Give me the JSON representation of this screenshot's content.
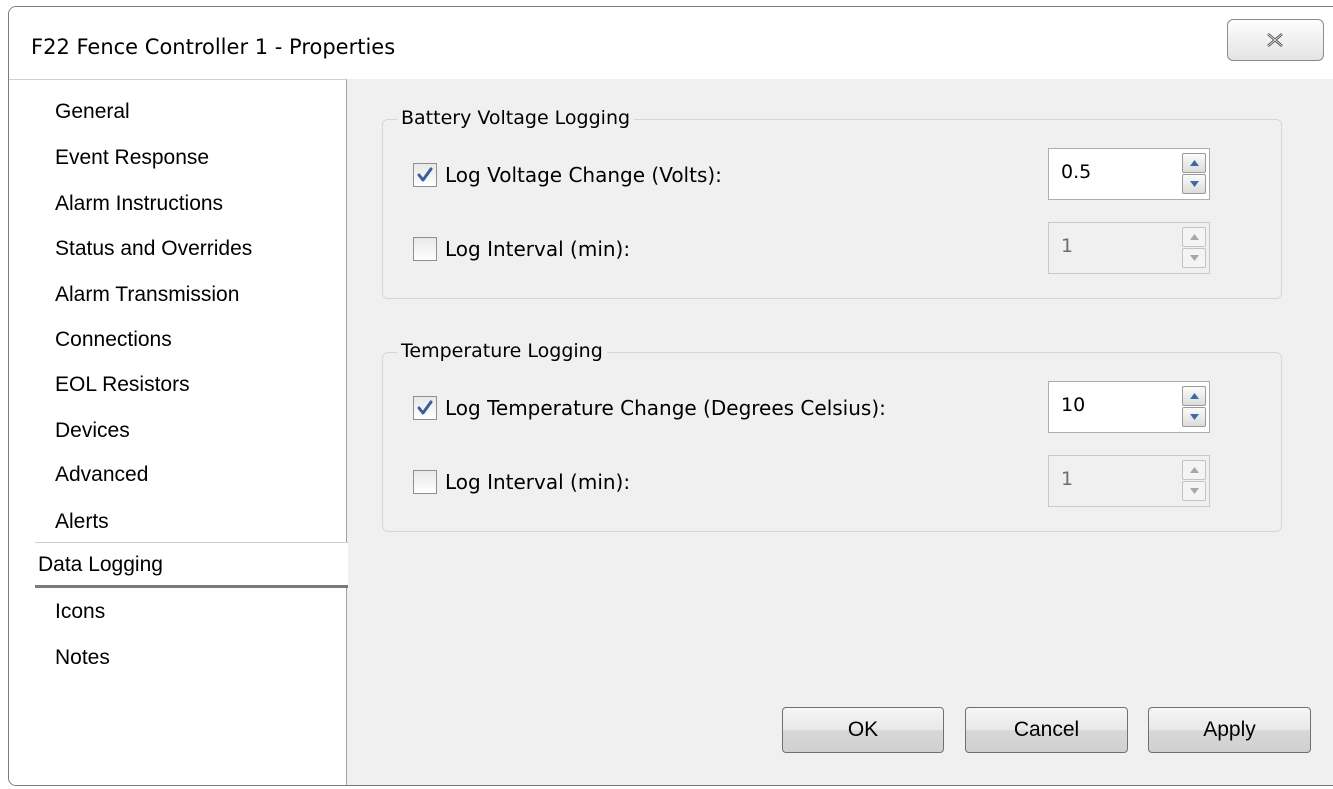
{
  "window": {
    "title": "F22 Fence Controller 1 - Properties"
  },
  "sidebar": {
    "items": [
      {
        "label": "General"
      },
      {
        "label": "Event Response"
      },
      {
        "label": "Alarm Instructions"
      },
      {
        "label": "Status and Overrides"
      },
      {
        "label": "Alarm Transmission"
      },
      {
        "label": "Connections"
      },
      {
        "label": "EOL Resistors"
      },
      {
        "label": "Devices"
      },
      {
        "label": "Advanced"
      },
      {
        "label": "Alerts"
      },
      {
        "label": "Data Logging",
        "selected": true
      },
      {
        "label": "Icons"
      },
      {
        "label": "Notes"
      }
    ]
  },
  "battery": {
    "title": "Battery Voltage Logging",
    "change_label": "Log Voltage Change (Volts):",
    "change_checked": true,
    "change_value": "0.5",
    "interval_label": "Log Interval (min):",
    "interval_checked": false,
    "interval_value": "1"
  },
  "temperature": {
    "title": "Temperature Logging",
    "change_label": "Log Temperature Change (Degrees Celsius):",
    "change_checked": true,
    "change_value": "10",
    "interval_label": "Log Interval (min):",
    "interval_checked": false,
    "interval_value": "1"
  },
  "buttons": {
    "ok": "OK",
    "cancel": "Cancel",
    "apply": "Apply"
  },
  "icons": {
    "close": "close-x-icon",
    "check": "checkmark-icon",
    "spin_up": "arrow-up-icon",
    "spin_down": "arrow-down-icon"
  },
  "colors": {
    "check_mark": "#3a5f9a",
    "window_bg": "#f0f0f0",
    "sidebar_bg": "#ffffff"
  }
}
